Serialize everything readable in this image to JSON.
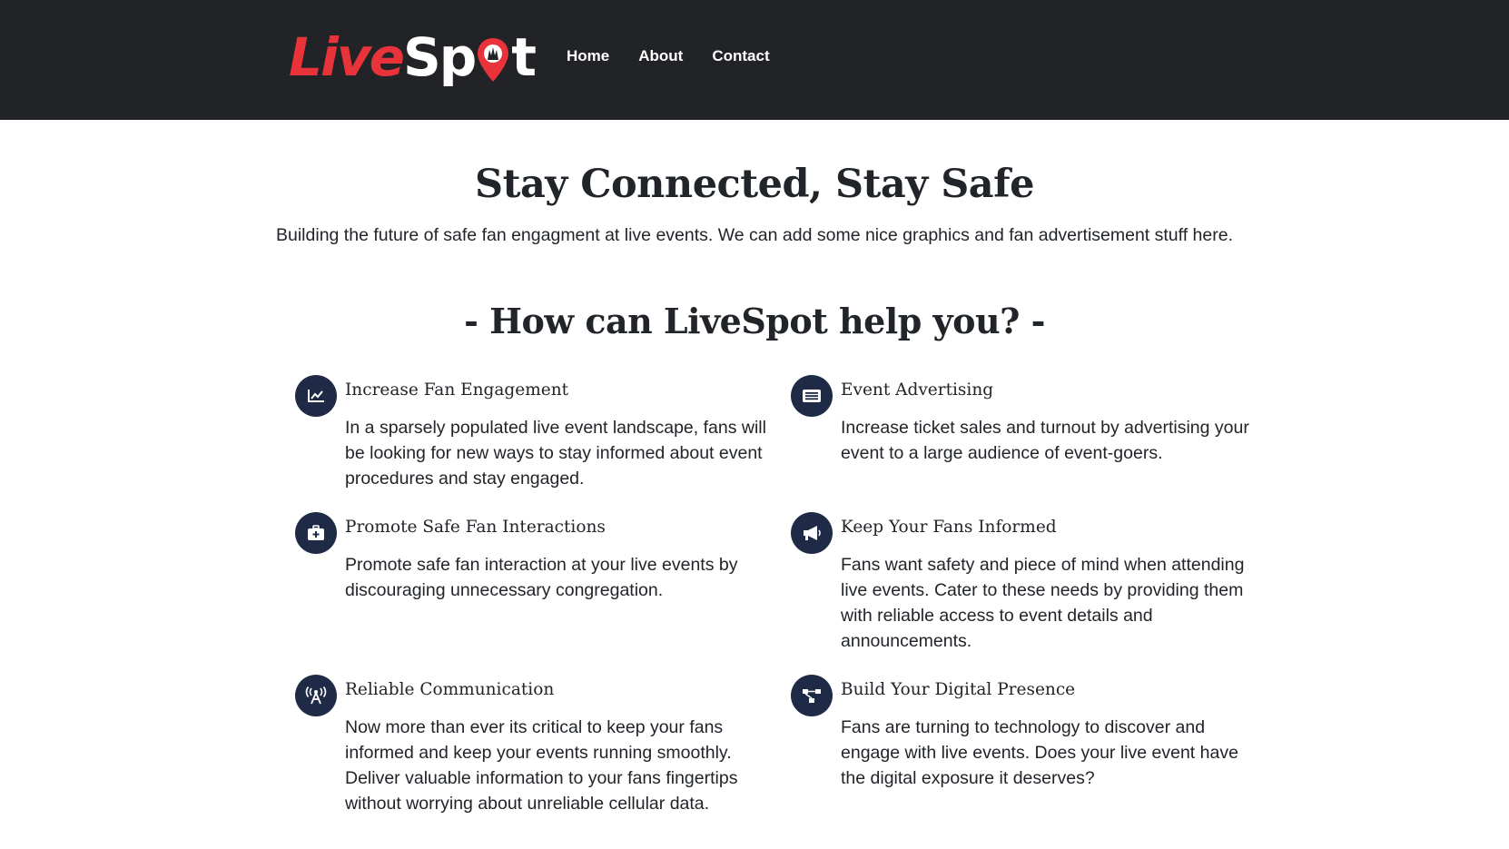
{
  "brand": {
    "logo_text_1": "Live",
    "logo_text_2": "Sp",
    "logo_text_3": "t"
  },
  "nav": {
    "home": "Home",
    "about": "About",
    "contact": "Contact"
  },
  "hero": {
    "title": "Stay Connected, Stay Safe",
    "subtitle": "Building the future of safe fan engagment at live events. We can add some nice graphics and fan advertisement stuff here."
  },
  "section": {
    "title": "- How can LiveSpot help you? -"
  },
  "features": [
    {
      "icon": "chart-line-icon",
      "title": "Increase Fan Engagement",
      "desc": "In a sparsely populated live event landscape, fans will be looking for new ways to stay informed about event procedures and stay engaged."
    },
    {
      "icon": "newspaper-icon",
      "title": "Event Advertising",
      "desc": "Increase ticket sales and turnout by advertising your event to a large audience of event-goers."
    },
    {
      "icon": "medkit-icon",
      "title": "Promote Safe Fan Interactions",
      "desc": "Promote safe fan interaction at your live events by discouraging unnecessary congregation."
    },
    {
      "icon": "megaphone-icon",
      "title": "Keep Your Fans Informed",
      "desc": "Fans want safety and piece of mind when attending live events. Cater to these needs by providing them with reliable access to event details and announcements."
    },
    {
      "icon": "broadcast-tower-icon",
      "title": "Reliable Communication",
      "desc": "Now more than ever its critical to keep your fans informed and keep your events running smoothly. Deliver valuable information to your fans fingertips without worrying about unreliable cellular data."
    },
    {
      "icon": "project-diagram-icon",
      "title": "Build Your Digital Presence",
      "desc": "Fans are turning to technology to discover and engage with live events. Does your live event have the digital exposure it deserves?"
    }
  ],
  "colors": {
    "navbar": "#212326",
    "brand_red": "#e8333b",
    "icon_bg": "#1f2b46",
    "text": "#212529"
  }
}
